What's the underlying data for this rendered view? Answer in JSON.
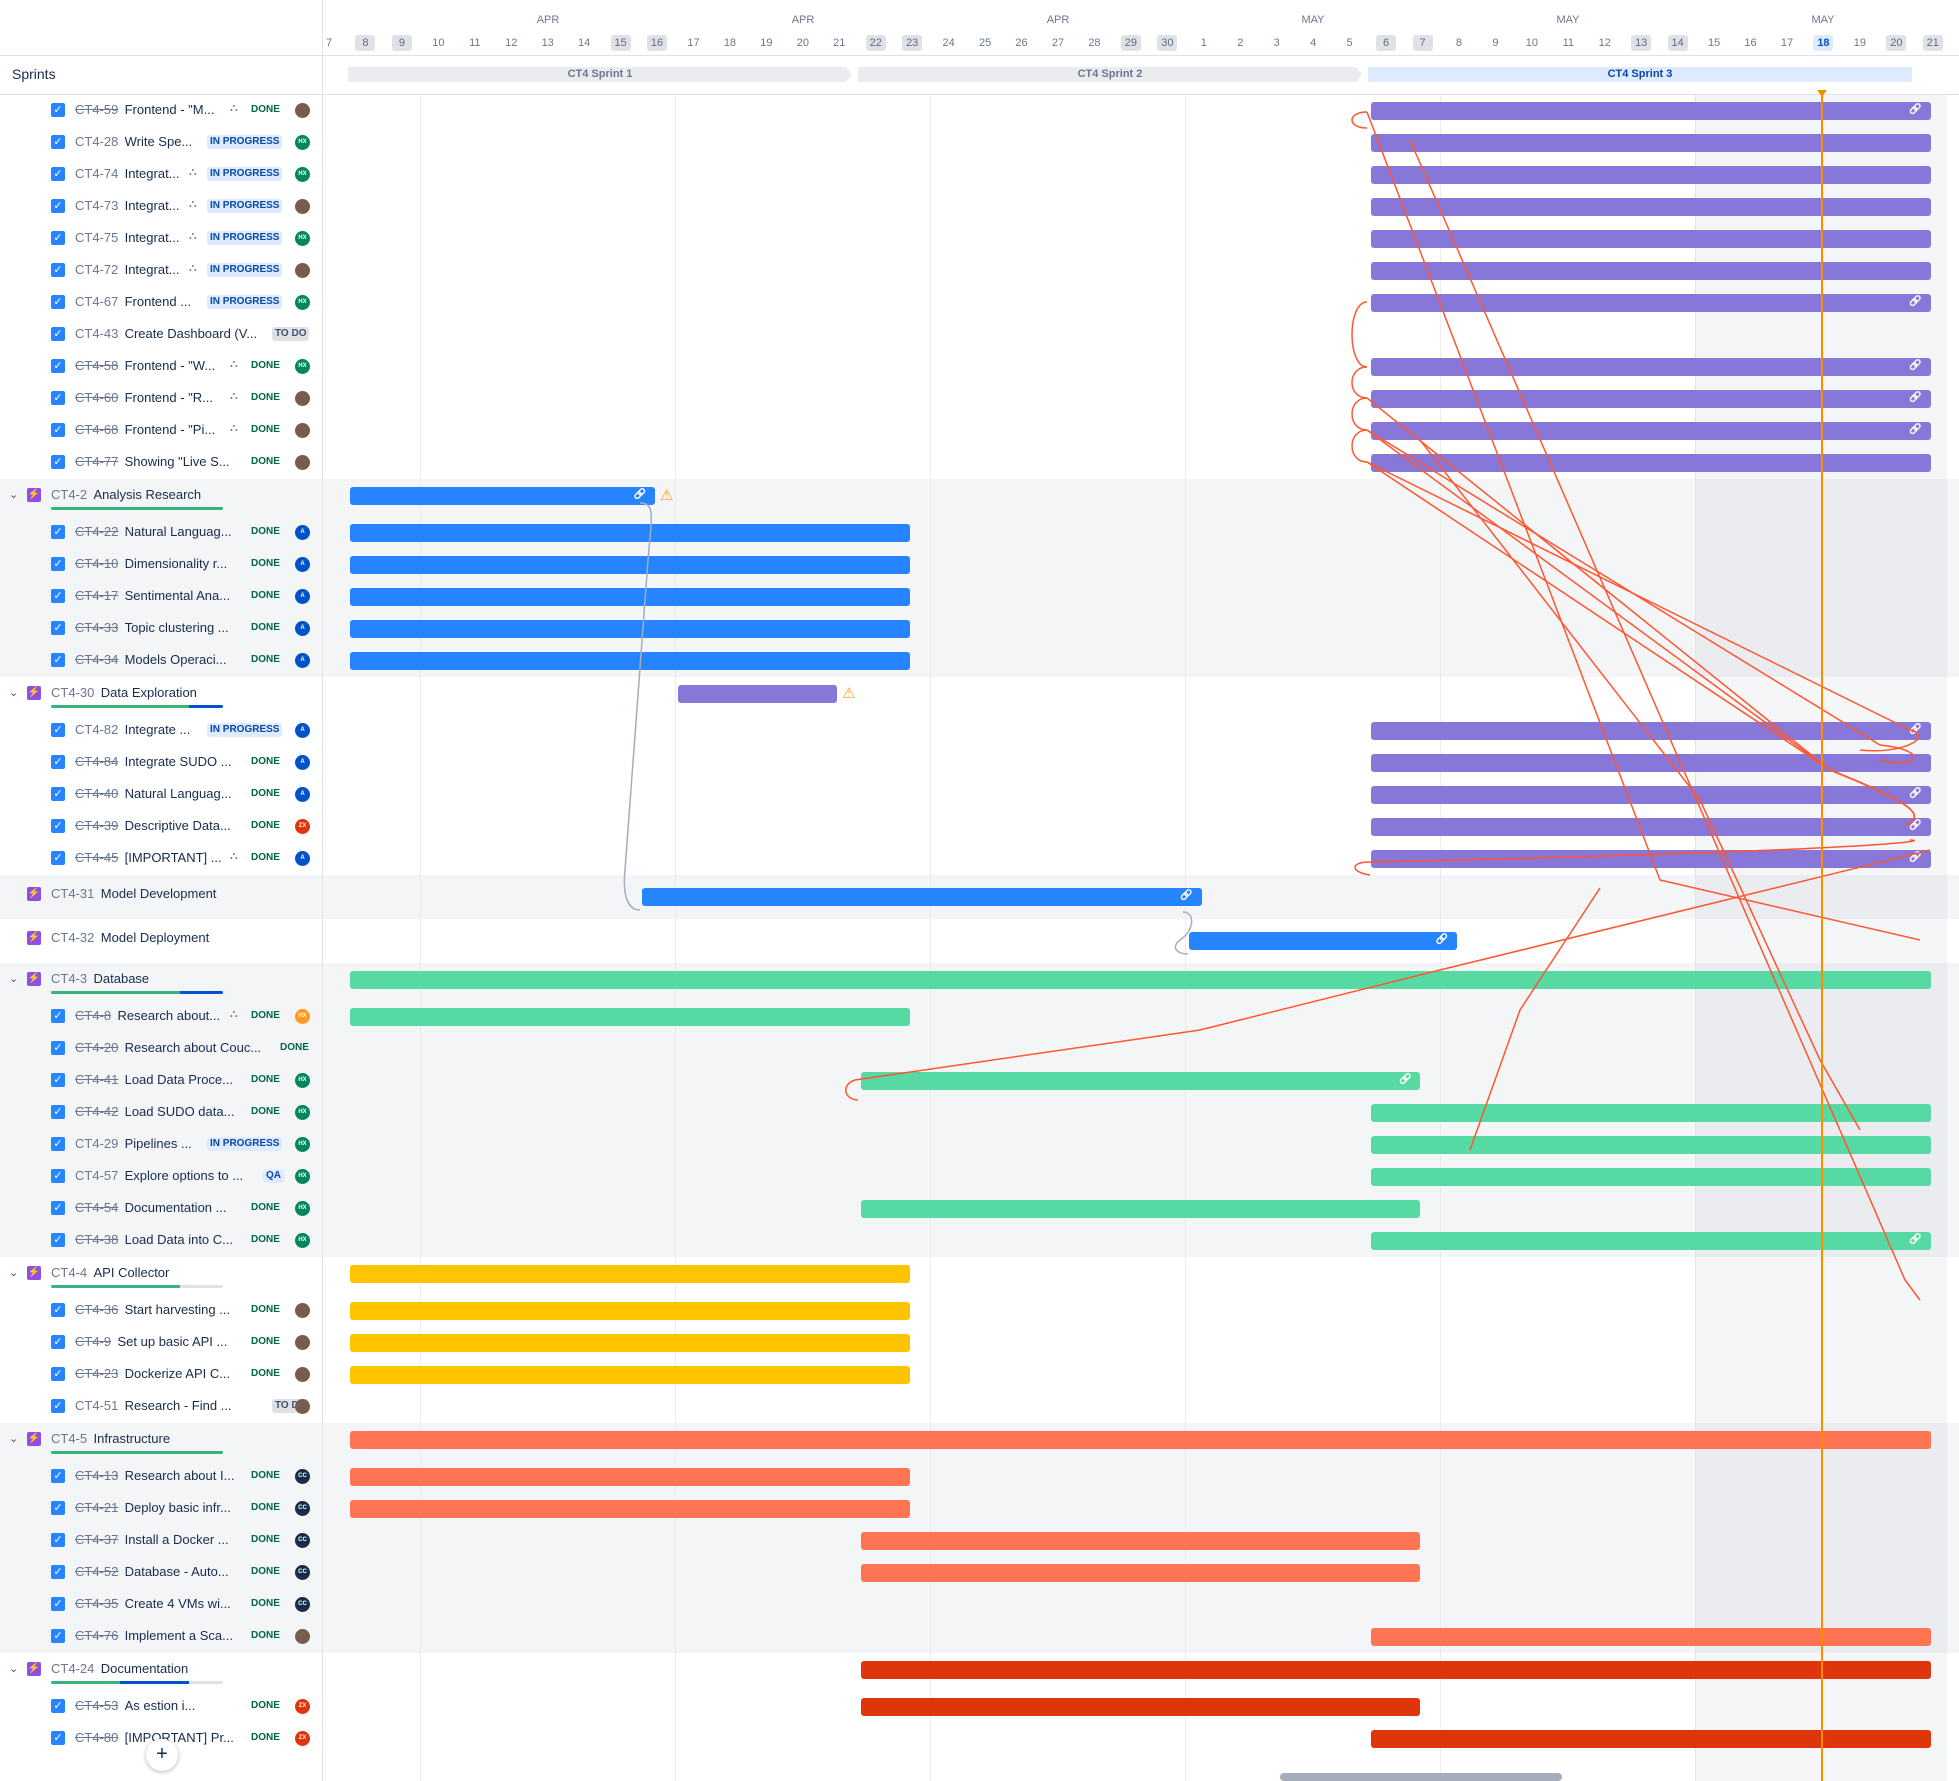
{
  "header": {
    "sprints_label": "Sprints"
  },
  "months": [
    "APR",
    "APR",
    "APR",
    "MAY",
    "MAY",
    "MAY"
  ],
  "days": [
    "7",
    "8",
    "9",
    "10",
    "11",
    "12",
    "13",
    "14",
    "15",
    "16",
    "17",
    "18",
    "19",
    "20",
    "21",
    "22",
    "23",
    "24",
    "25",
    "26",
    "27",
    "28",
    "29",
    "30",
    "1",
    "2",
    "3",
    "4",
    "5",
    "6",
    "7",
    "8",
    "9",
    "10",
    "11",
    "12",
    "13",
    "14",
    "15",
    "16",
    "17",
    "18",
    "19",
    "20",
    "21"
  ],
  "sprints": [
    "CT4 Sprint 1",
    "CT4 Sprint 2",
    "CT4 Sprint 3"
  ],
  "today_day": "18",
  "colors": {
    "purple": "#8777d9",
    "blue": "#2684ff",
    "green": "#57d9a3",
    "yellow": "#ffc400",
    "salmon": "#ff7452",
    "red": "#de350b",
    "dep": "#ff5630"
  },
  "rows": [
    {
      "type": "issue",
      "key": "CT4-59",
      "summary": "Frontend - \"M...",
      "status": "DONE",
      "av": "photo",
      "hier": true,
      "color": "purple",
      "start": 29,
      "end": 44,
      "link": true
    },
    {
      "type": "issue",
      "key": "CT4-28",
      "summary": "Write Spe...",
      "status": "IN PROGRESS",
      "av": "HX",
      "color": "purple",
      "start": 29,
      "end": 44
    },
    {
      "type": "issue",
      "key": "CT4-74",
      "summary": "Integrat...",
      "status": "IN PROGRESS",
      "av": "HX",
      "hier": true,
      "color": "purple",
      "start": 29,
      "end": 44
    },
    {
      "type": "issue",
      "key": "CT4-73",
      "summary": "Integrat...",
      "status": "IN PROGRESS",
      "av": "photo",
      "hier": true,
      "color": "purple",
      "start": 29,
      "end": 44
    },
    {
      "type": "issue",
      "key": "CT4-75",
      "summary": "Integrat...",
      "status": "IN PROGRESS",
      "av": "HX",
      "hier": true,
      "color": "purple",
      "start": 29,
      "end": 44
    },
    {
      "type": "issue",
      "key": "CT4-72",
      "summary": "Integrat...",
      "status": "IN PROGRESS",
      "av": "photo",
      "hier": true,
      "color": "purple",
      "start": 29,
      "end": 44
    },
    {
      "type": "issue",
      "key": "CT4-67",
      "summary": "Frontend ...",
      "status": "IN PROGRESS",
      "av": "HX",
      "color": "purple",
      "start": 29,
      "end": 44,
      "link": true
    },
    {
      "type": "issue",
      "key": "CT4-43",
      "summary": "Create Dashboard (V...",
      "status": "TO DO",
      "av": "",
      "color": "",
      "start": null,
      "end": null
    },
    {
      "type": "issue",
      "key": "CT4-58",
      "summary": "Frontend - \"W...",
      "status": "DONE",
      "av": "HX",
      "hier": true,
      "color": "purple",
      "start": 29,
      "end": 44,
      "link": true
    },
    {
      "type": "issue",
      "key": "CT4-60",
      "summary": "Frontend - \"R...",
      "status": "DONE",
      "av": "photo",
      "hier": true,
      "color": "purple",
      "start": 29,
      "end": 44,
      "link": true
    },
    {
      "type": "issue",
      "key": "CT4-68",
      "summary": "Frontend - \"Pi...",
      "status": "DONE",
      "av": "photo",
      "hier": true,
      "color": "purple",
      "start": 29,
      "end": 44,
      "link": true
    },
    {
      "type": "issue",
      "key": "CT4-77",
      "summary": "Showing \"Live S...",
      "status": "DONE",
      "av": "photo",
      "color": "purple",
      "start": 29,
      "end": 44
    },
    {
      "type": "epic",
      "key": "CT4-2",
      "summary": "Analysis Research",
      "chev": true,
      "green": 1.0,
      "blue": 0,
      "color": "blue",
      "start": 1,
      "end": 9,
      "link": true,
      "warn": true
    },
    {
      "type": "issue",
      "key": "CT4-22",
      "summary": "Natural Languag...",
      "status": "DONE",
      "av": "A",
      "color": "blue",
      "start": 1,
      "end": 16
    },
    {
      "type": "issue",
      "key": "CT4-10",
      "summary": "Dimensionality r...",
      "status": "DONE",
      "av": "A",
      "color": "blue",
      "start": 1,
      "end": 16
    },
    {
      "type": "issue",
      "key": "CT4-17",
      "summary": "Sentimental Ana...",
      "status": "DONE",
      "av": "A",
      "color": "blue",
      "start": 1,
      "end": 16
    },
    {
      "type": "issue",
      "key": "CT4-33",
      "summary": "Topic clustering ...",
      "status": "DONE",
      "av": "A",
      "color": "blue",
      "start": 1,
      "end": 16
    },
    {
      "type": "issue",
      "key": "CT4-34",
      "summary": "Models Operaci...",
      "status": "DONE",
      "av": "A",
      "color": "blue",
      "start": 1,
      "end": 16
    },
    {
      "type": "epic",
      "key": "CT4-30",
      "summary": "Data Exploration",
      "chev": true,
      "green": 0.8,
      "blue": 0.2,
      "color": "purple",
      "start": 10,
      "end": 14,
      "warn": true
    },
    {
      "type": "issue",
      "key": "CT4-82",
      "summary": "Integrate ...",
      "status": "IN PROGRESS",
      "av": "A",
      "color": "purple",
      "start": 29,
      "end": 44,
      "link": true
    },
    {
      "type": "issue",
      "key": "CT4-84",
      "summary": "Integrate SUDO ...",
      "status": "DONE",
      "av": "A",
      "color": "purple",
      "start": 29,
      "end": 44
    },
    {
      "type": "issue",
      "key": "CT4-40",
      "summary": "Natural Languag...",
      "status": "DONE",
      "av": "A",
      "color": "purple",
      "start": 29,
      "end": 44,
      "link": true
    },
    {
      "type": "issue",
      "key": "CT4-39",
      "summary": "Descriptive Data...",
      "status": "DONE",
      "av": "ZX",
      "color": "purple",
      "start": 29,
      "end": 44,
      "link": true
    },
    {
      "type": "issue",
      "key": "CT4-45",
      "summary": "[IMPORTANT] ...",
      "status": "DONE",
      "av": "A",
      "hier": true,
      "color": "purple",
      "start": 29,
      "end": 44,
      "link": true
    },
    {
      "type": "epic",
      "key": "CT4-31",
      "summary": "Model Development",
      "chev": false,
      "color": "blue",
      "start": 9,
      "end": 24,
      "link": true
    },
    {
      "type": "epic",
      "key": "CT4-32",
      "summary": "Model Deployment",
      "chev": false,
      "color": "blue",
      "start": 24,
      "end": 31,
      "link": true
    },
    {
      "type": "epic",
      "key": "CT4-3",
      "summary": "Database",
      "chev": true,
      "green": 0.75,
      "blue": 0.25,
      "color": "green",
      "start": 1,
      "end": 44
    },
    {
      "type": "issue",
      "key": "CT4-8",
      "summary": "Research about...",
      "status": "DONE",
      "av": "HX",
      "hier": true,
      "color": "green",
      "start": 1,
      "end": 16
    },
    {
      "type": "issue",
      "key": "CT4-20",
      "summary": "Research about Couc...",
      "status": "DONE",
      "av": "",
      "color": "",
      "start": null,
      "end": null
    },
    {
      "type": "issue",
      "key": "CT4-41",
      "summary": "Load Data Proce...",
      "status": "DONE",
      "av": "HX",
      "color": "green",
      "start": 15,
      "end": 30,
      "link": true
    },
    {
      "type": "issue",
      "key": "CT4-42",
      "summary": "Load SUDO data...",
      "status": "DONE",
      "av": "HX",
      "color": "green",
      "start": 29,
      "end": 44
    },
    {
      "type": "issue",
      "key": "CT4-29",
      "summary": "Pipelines ...",
      "status": "IN PROGRESS",
      "av": "HX",
      "color": "green",
      "start": 29,
      "end": 44
    },
    {
      "type": "issue",
      "key": "CT4-57",
      "summary": "Explore options to ...",
      "status": "QA",
      "av": "HX",
      "color": "green",
      "start": 29,
      "end": 44
    },
    {
      "type": "issue",
      "key": "CT4-54",
      "summary": "Documentation ...",
      "status": "DONE",
      "av": "HX",
      "color": "green",
      "start": 15,
      "end": 30
    },
    {
      "type": "issue",
      "key": "CT4-38",
      "summary": "Load Data into C...",
      "status": "DONE",
      "av": "HX",
      "color": "green",
      "start": 29,
      "end": 44,
      "link": true
    },
    {
      "type": "epic",
      "key": "CT4-4",
      "summary": "API Collector",
      "chev": true,
      "green": 0.75,
      "blue": 0,
      "color": "yellow",
      "start": 1,
      "end": 16
    },
    {
      "type": "issue",
      "key": "CT4-36",
      "summary": "Start harvesting ...",
      "status": "DONE",
      "av": "photo",
      "color": "yellow",
      "start": 1,
      "end": 16
    },
    {
      "type": "issue",
      "key": "CT4-9",
      "summary": "Set up basic API ...",
      "status": "DONE",
      "av": "photo",
      "color": "yellow",
      "start": 1,
      "end": 16
    },
    {
      "type": "issue",
      "key": "CT4-23",
      "summary": "Dockerize API C...",
      "status": "DONE",
      "av": "photo",
      "color": "yellow",
      "start": 1,
      "end": 16
    },
    {
      "type": "issue",
      "key": "CT4-51",
      "summary": "Research - Find ...",
      "status": "TO DO",
      "av": "photo",
      "color": "",
      "start": null,
      "end": null
    },
    {
      "type": "epic",
      "key": "CT4-5",
      "summary": "Infrastructure",
      "chev": true,
      "green": 1.0,
      "blue": 0,
      "color": "salmon",
      "start": 1,
      "end": 44
    },
    {
      "type": "issue",
      "key": "CT4-13",
      "summary": "Research about I...",
      "status": "DONE",
      "av": "CC",
      "color": "salmon",
      "start": 1,
      "end": 16
    },
    {
      "type": "issue",
      "key": "CT4-21",
      "summary": "Deploy basic infr...",
      "status": "DONE",
      "av": "CC",
      "color": "salmon",
      "start": 1,
      "end": 16
    },
    {
      "type": "issue",
      "key": "CT4-37",
      "summary": "Install a Docker ...",
      "status": "DONE",
      "av": "CC",
      "color": "salmon",
      "start": 15,
      "end": 30
    },
    {
      "type": "issue",
      "key": "CT4-52",
      "summary": "Database - Auto...",
      "status": "DONE",
      "av": "CC",
      "color": "salmon",
      "start": 15,
      "end": 30
    },
    {
      "type": "issue",
      "key": "CT4-35",
      "summary": "Create 4 VMs wi...",
      "status": "DONE",
      "av": "CC",
      "color": "",
      "start": null,
      "end": null
    },
    {
      "type": "issue",
      "key": "CT4-76",
      "summary": "Implement a Sca...",
      "status": "DONE",
      "av": "photo",
      "color": "salmon",
      "start": 29,
      "end": 44
    },
    {
      "type": "epic",
      "key": "CT4-24",
      "summary": "Documentation",
      "chev": true,
      "green": 0.4,
      "blue": 0.4,
      "color": "red",
      "start": 15,
      "end": 44
    },
    {
      "type": "issue",
      "key": "CT4-53",
      "summary": "As   estion i...",
      "status": "DONE",
      "av": "ZX",
      "color": "red",
      "start": 15,
      "end": 30
    },
    {
      "type": "issue",
      "key": "CT4-80",
      "summary": "[IMPORTANT] Pr...",
      "status": "DONE",
      "av": "ZX",
      "color": "red",
      "start": 29,
      "end": 44
    }
  ]
}
